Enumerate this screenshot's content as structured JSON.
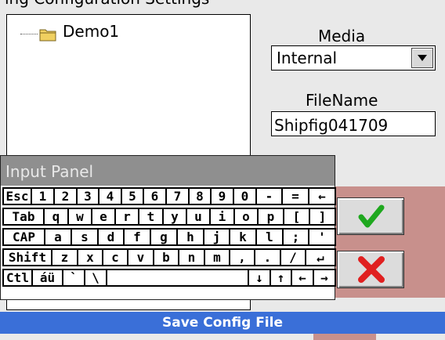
{
  "top_text": "ing Configuration Settings",
  "tree": {
    "folder_label": "Demo1"
  },
  "media": {
    "label": "Media",
    "value": "Internal"
  },
  "filename": {
    "label": "FileName",
    "value": "Shipfig041709"
  },
  "input_panel": {
    "title": "Input Panel",
    "rows": [
      [
        "Esc",
        "1",
        "2",
        "3",
        "4",
        "5",
        "6",
        "7",
        "8",
        "9",
        "0",
        "-",
        "=",
        "←"
      ],
      [
        "Tab",
        "q",
        "w",
        "e",
        "r",
        "t",
        "y",
        "u",
        "i",
        "o",
        "p",
        "[",
        "]"
      ],
      [
        "CAP",
        "a",
        "s",
        "d",
        "f",
        "g",
        "h",
        "j",
        "k",
        "l",
        ";",
        "'"
      ],
      [
        "Shift",
        "z",
        "x",
        "c",
        "v",
        "b",
        "n",
        "m",
        ",",
        ".",
        "/",
        "↵"
      ],
      [
        "Ctl",
        "áü",
        "`",
        "\\",
        "",
        "↓",
        "↑",
        "←",
        "→"
      ]
    ]
  },
  "buttons": {
    "ok": "ok",
    "cancel": "cancel"
  },
  "footer": {
    "title": "Save Config File"
  },
  "colors": {
    "accent": "#3a6fd8",
    "ok": "#1fa81f",
    "cancel": "#e02020",
    "panel": "#c8908c"
  }
}
